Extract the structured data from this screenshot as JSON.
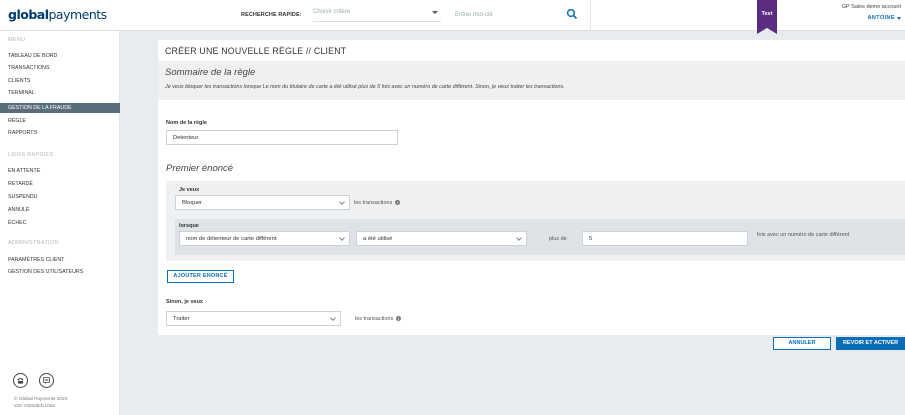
{
  "header": {
    "logo_bold": "global",
    "logo_light": "payments",
    "quick_search_label": "RECHERCHE RAPIDE:",
    "criteria_placeholder": "Choisir critère",
    "keyword_placeholder": "Entrer mot-clé",
    "env_badge": "Test",
    "account_name": "GP Sales demo account",
    "user_name": "ANTOINE",
    "colors": {
      "brand": "#003a70",
      "accent": "#0a6db8",
      "badge": "#5b2d82"
    }
  },
  "sidebar": {
    "menu_heading": "MENU",
    "menu_items": [
      {
        "label": "TABLEAU DE BORD"
      },
      {
        "label": "TRANSACTIONS"
      },
      {
        "label": "CLIENTS"
      },
      {
        "label": "TERMINAL"
      },
      {
        "label": "GESTION DE LA FRAUDE",
        "active": true
      },
      {
        "label": "RÈGLE"
      },
      {
        "label": "RAPPORTS"
      }
    ],
    "quick_links_heading": "LIENS RAPIDES",
    "quick_links": [
      {
        "label": "EN ATTENTE"
      },
      {
        "label": "RETARDÉ"
      },
      {
        "label": "SUSPENDU"
      },
      {
        "label": "ANNULÉ"
      },
      {
        "label": "ÉCHEC"
      }
    ],
    "admin_heading": "ADMINISTRATION",
    "admin_items": [
      {
        "label": "PARAMÈTRES CLIENT"
      },
      {
        "label": "GESTION DES UTILISATEURS"
      }
    ],
    "footer_icons": [
      "phone-icon",
      "chat-icon"
    ],
    "copyright": "© Global Payments 2023",
    "version": "v25-7d450bdc10a4"
  },
  "main": {
    "page_title": "CRÉER UNE NOUVELLE RÈGLE // CLIENT",
    "summary_title": "Sommaire de la règle",
    "summary_text": "Je veux bloquer les transactions lorsque Le nom du titulaire de carte a été utilisé plus de 5 fois avec un numéro de carte différent. Sinon, je veux traiter les transactions.",
    "rule_name_label": "Nom de la règle",
    "rule_name_value": "Detenteur",
    "statement_title": "Premier énoncé",
    "want_label": "Je veux",
    "want_value": "Bloquer",
    "transactions_text": "les transactions",
    "when_label": "lorsque",
    "condition_value": "nom de détenteur de carte différent",
    "operator_value": "a été utilisé",
    "more_than_text": "plus de",
    "count_value": "5",
    "suffix_text": "fois avec un numéro de carte différent",
    "add_statement_label": "AJOUTER ENONCÉ",
    "else_label": "Sinon, je veux",
    "else_value": "Traiter",
    "else_transactions_text": "les transactions"
  },
  "footer_actions": {
    "cancel_label": "ANNULER",
    "save_label": "REVOIR ET ACTIVER"
  }
}
